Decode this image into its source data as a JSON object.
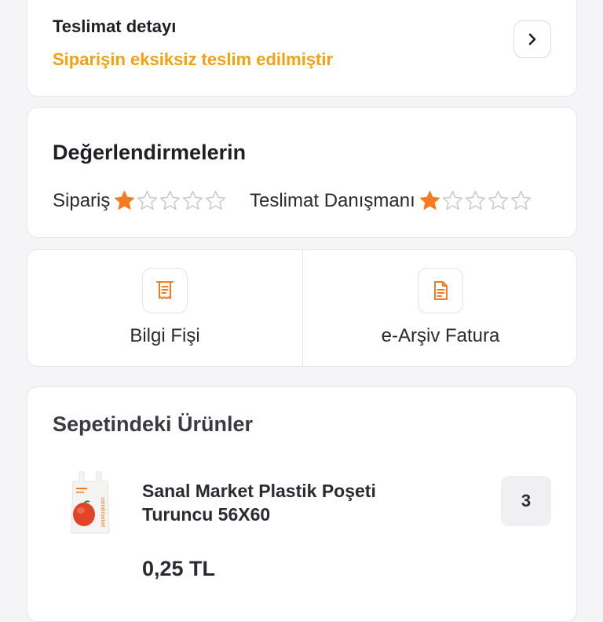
{
  "delivery": {
    "title": "Teslimat detayı",
    "status": "Siparişin eksiksiz teslim edilmiştir",
    "status_color": "#f4a00f"
  },
  "ratings": {
    "title": "Değerlendirmelerin",
    "items": [
      {
        "label": "Sipariş",
        "stars": 1,
        "max": 5
      },
      {
        "label": "Teslimat Danışmanı",
        "stars": 1,
        "max": 5
      }
    ],
    "star_color": "#f47b20"
  },
  "documents": [
    {
      "label": "Bilgi Fişi",
      "icon": "receipt-icon"
    },
    {
      "label": "e-Arşiv Fatura",
      "icon": "invoice-icon"
    }
  ],
  "basket": {
    "title": "Sepetindeki Ürünler",
    "products": [
      {
        "name": "Sanal Market Plastik Poşeti Turuncu 56X60",
        "quantity": "3",
        "price": "0,25 TL",
        "image_icon": "plastic-bag-image",
        "image_text": "sanalmarket"
      }
    ]
  },
  "icon_names": {
    "chevron": "chevron-right-icon",
    "star_filled": "star-filled-icon",
    "star_empty": "star-empty-icon"
  }
}
